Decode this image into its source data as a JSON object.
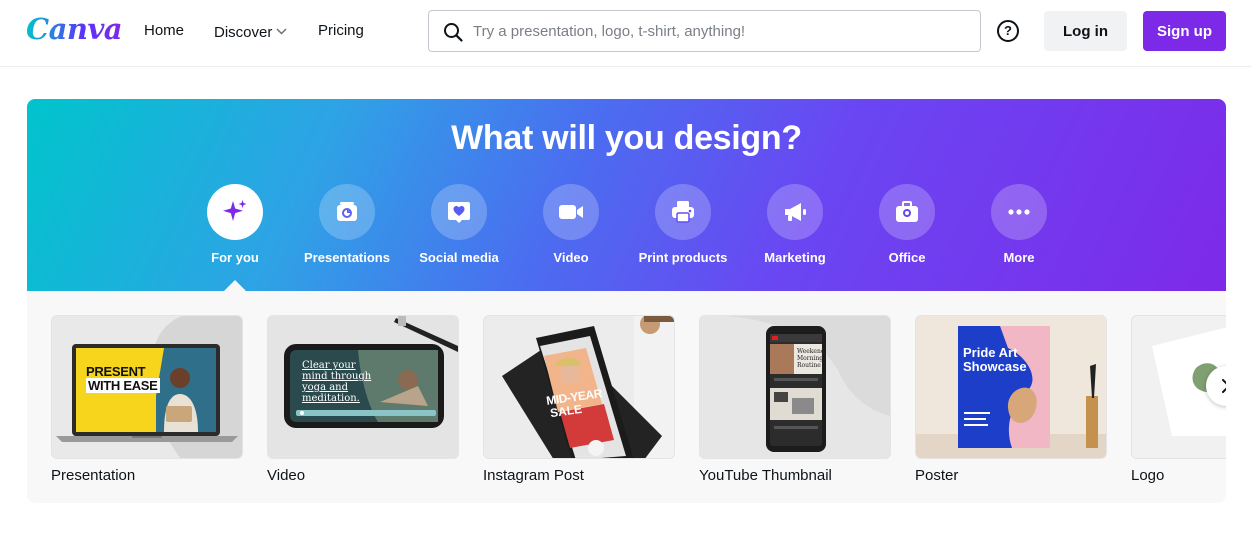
{
  "brand": {
    "logo_text": "Canva",
    "accent": "#7d2ae8"
  },
  "nav": {
    "home": "Home",
    "discover": "Discover",
    "pricing": "Pricing"
  },
  "search": {
    "placeholder": "Try a presentation, logo, t-shirt, anything!",
    "value": ""
  },
  "header_actions": {
    "help": "?",
    "login": "Log in",
    "signup": "Sign up"
  },
  "hero": {
    "title": "What will you design?",
    "categories": [
      {
        "label": "For you",
        "icon": "sparkle-icon",
        "active": true
      },
      {
        "label": "Presentations",
        "icon": "presentation-icon"
      },
      {
        "label": "Social media",
        "icon": "heart-chat-icon"
      },
      {
        "label": "Video",
        "icon": "video-camera-icon"
      },
      {
        "label": "Print products",
        "icon": "printer-icon"
      },
      {
        "label": "Marketing",
        "icon": "megaphone-icon"
      },
      {
        "label": "Office",
        "icon": "briefcase-icon"
      },
      {
        "label": "More",
        "icon": "more-dots-icon"
      }
    ]
  },
  "gallery": {
    "items": [
      {
        "label": "Presentation",
        "thumb_text": [
          "PRESENT",
          "WITH EASE"
        ]
      },
      {
        "label": "Video",
        "thumb_text": [
          "Clear your",
          "mind through",
          "yoga and",
          "meditation."
        ]
      },
      {
        "label": "Instagram Post",
        "thumb_text": [
          "MID-YEAR",
          "SALE"
        ]
      },
      {
        "label": "YouTube Thumbnail",
        "thumb_text": [
          "Weekend",
          "Morning",
          "Routine"
        ]
      },
      {
        "label": "Poster",
        "thumb_text": [
          "Pride Art",
          "Showcase"
        ]
      },
      {
        "label": "Logo",
        "thumb_text": []
      }
    ],
    "next_icon": "chevron-right-icon"
  }
}
